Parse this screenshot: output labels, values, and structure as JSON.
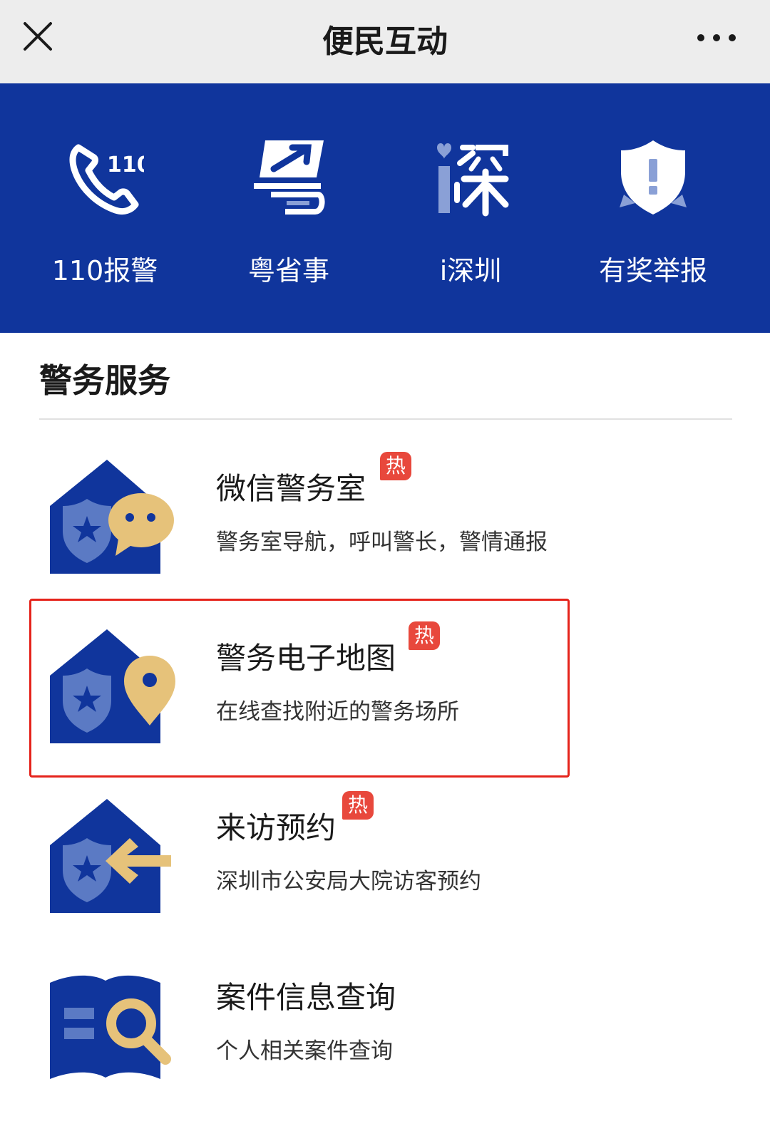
{
  "header": {
    "title": "便民互动",
    "close_icon": "close-icon",
    "more_icon": "more-icon"
  },
  "colors": {
    "banner": "#10359c",
    "hot": "#e8483c",
    "highlight": "#e5231b",
    "gold": "#e6c27a"
  },
  "shortcuts": [
    {
      "label": "110报警",
      "icon": "phone-110-icon",
      "icon_text": "110"
    },
    {
      "label": "粤省事",
      "icon": "yue-logo-icon"
    },
    {
      "label": "i深圳",
      "icon": "i-shenzhen-logo-icon"
    },
    {
      "label": "有奖举报",
      "icon": "shield-alert-icon"
    }
  ],
  "section": {
    "title": "警务服务"
  },
  "services": [
    {
      "name": "微信警务室",
      "hot": "热",
      "desc": "警务室导航，呼叫警长，警情通报",
      "icon": "police-chat-icon"
    },
    {
      "name": "警务电子地图",
      "hot": "热",
      "desc": "在线查找附近的警务场所",
      "icon": "police-map-pin-icon",
      "highlighted": true
    },
    {
      "name": "来访预约",
      "hot": "热",
      "desc": "深圳市公安局大院访客预约",
      "icon": "police-arrow-icon"
    },
    {
      "name": "案件信息查询",
      "hot": "",
      "desc": "个人相关案件查询",
      "icon": "case-search-icon"
    }
  ]
}
